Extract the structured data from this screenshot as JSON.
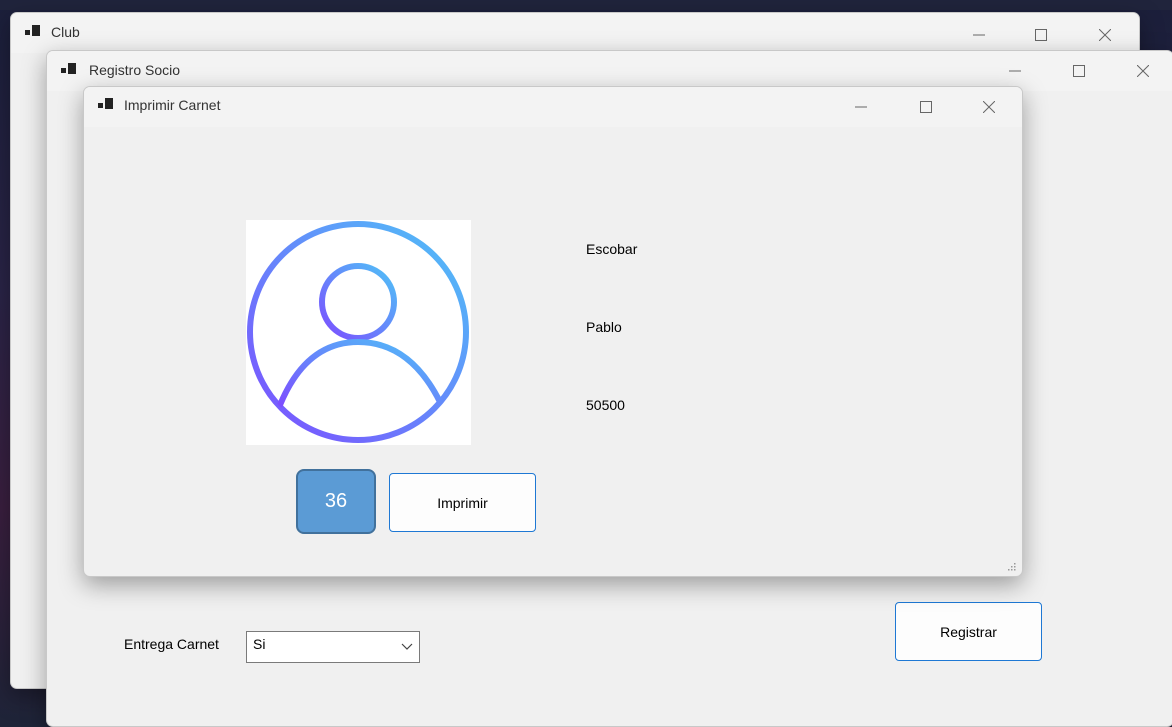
{
  "windows": {
    "club": {
      "title": "Club"
    },
    "registro": {
      "title": "Registro Socio",
      "entrega_label": "Entrega Carnet",
      "entrega_value": "Si",
      "registrar_label": "Registrar"
    },
    "imprimir": {
      "title": "Imprimir Carnet",
      "apellido": "Escobar",
      "nombre": "Pablo",
      "numero": "50500",
      "badge_value": "36",
      "imprimir_label": "Imprimir"
    }
  },
  "icons": {
    "minimize": "minimize-icon",
    "maximize": "maximize-icon",
    "close": "close-icon",
    "app": "app-window-icon",
    "avatar": "user-avatar-icon",
    "dropdown": "chevron-down-icon"
  },
  "colors": {
    "button_border": "#1e78d4",
    "badge_fill": "#5b9bd5",
    "avatar_gradient_start": "#4fc3f7",
    "avatar_gradient_end": "#7c4dff"
  }
}
